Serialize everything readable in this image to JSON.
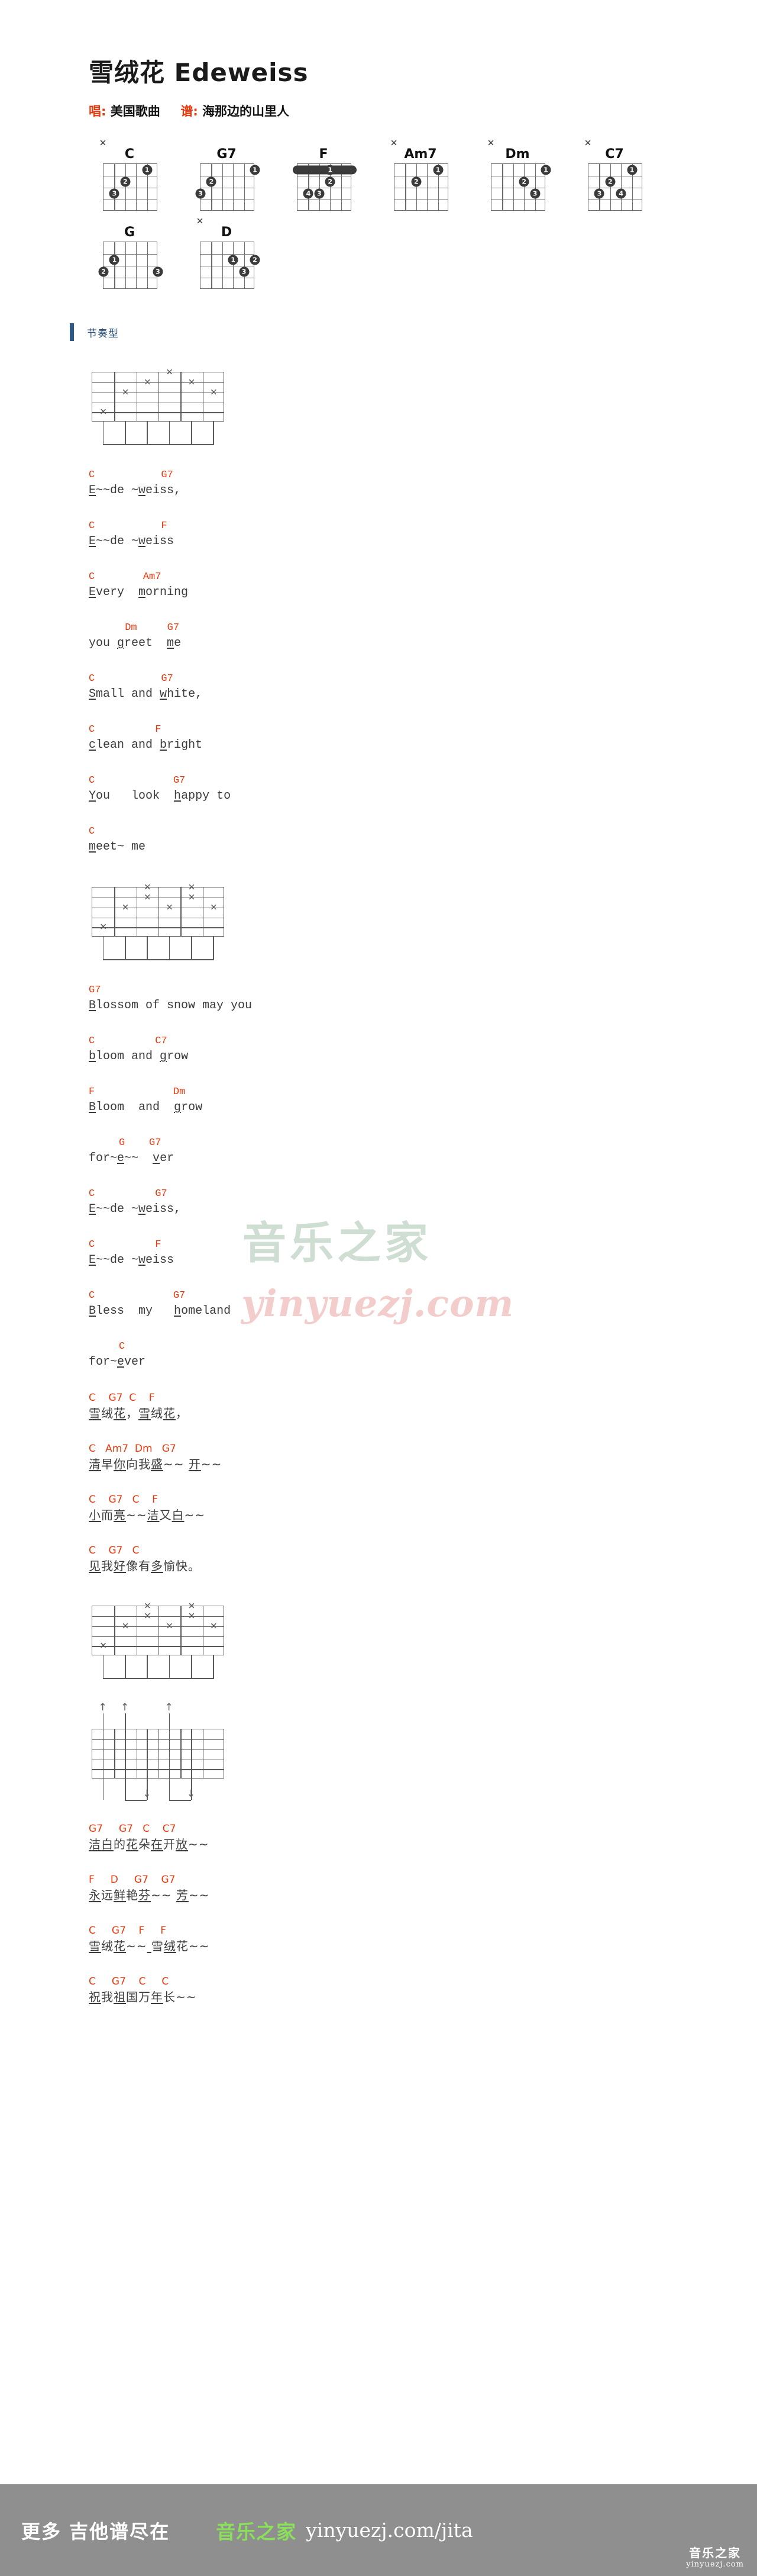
{
  "header": {
    "title": "雪绒花 Edeweiss",
    "singer_label": "唱:",
    "singer": "美国歌曲",
    "transcriber_label": "谱:",
    "transcriber": "海那边的山里人"
  },
  "chords": [
    {
      "name": "C",
      "mute_strings": [
        6
      ],
      "dots": [
        {
          "string": 2,
          "fret": 1,
          "finger": "1"
        },
        {
          "string": 4,
          "fret": 2,
          "finger": "2"
        },
        {
          "string": 5,
          "fret": 3,
          "finger": "3"
        }
      ],
      "barre": null
    },
    {
      "name": "G7",
      "mute_strings": [],
      "dots": [
        {
          "string": 1,
          "fret": 1,
          "finger": "1"
        },
        {
          "string": 5,
          "fret": 2,
          "finger": "2"
        },
        {
          "string": 6,
          "fret": 3,
          "finger": "3"
        }
      ],
      "barre": null
    },
    {
      "name": "F",
      "mute_strings": [],
      "dots": [
        {
          "string": 3,
          "fret": 2,
          "finger": "2"
        },
        {
          "string": 4,
          "fret": 3,
          "finger": "3"
        },
        {
          "string": 5,
          "fret": 3,
          "finger": "4"
        }
      ],
      "barre": {
        "fret": 1,
        "finger": "1",
        "from_string": 6,
        "to_string": 1
      }
    },
    {
      "name": "Am7",
      "mute_strings": [
        6
      ],
      "dots": [
        {
          "string": 2,
          "fret": 1,
          "finger": "1"
        },
        {
          "string": 4,
          "fret": 2,
          "finger": "2"
        }
      ],
      "barre": null
    },
    {
      "name": "Dm",
      "mute_strings": [
        6
      ],
      "dots": [
        {
          "string": 1,
          "fret": 1,
          "finger": "1"
        },
        {
          "string": 3,
          "fret": 2,
          "finger": "2"
        },
        {
          "string": 2,
          "fret": 3,
          "finger": "3"
        }
      ],
      "barre": null
    },
    {
      "name": "C7",
      "mute_strings": [
        6
      ],
      "dots": [
        {
          "string": 2,
          "fret": 1,
          "finger": "1"
        },
        {
          "string": 4,
          "fret": 2,
          "finger": "2"
        },
        {
          "string": 5,
          "fret": 3,
          "finger": "3"
        },
        {
          "string": 3,
          "fret": 3,
          "finger": "4"
        }
      ],
      "barre": null
    },
    {
      "name": "G",
      "mute_strings": [],
      "dots": [
        {
          "string": 5,
          "fret": 2,
          "finger": "1"
        },
        {
          "string": 6,
          "fret": 3,
          "finger": "2"
        },
        {
          "string": 1,
          "fret": 3,
          "finger": "3"
        }
      ],
      "barre": null
    },
    {
      "name": "D",
      "mute_strings": [
        6
      ],
      "dots": [
        {
          "string": 3,
          "fret": 2,
          "finger": "1"
        },
        {
          "string": 1,
          "fret": 2,
          "finger": "2"
        },
        {
          "string": 2,
          "fret": 3,
          "finger": "3"
        }
      ],
      "barre": null
    }
  ],
  "section": {
    "rhythm_label": "节奏型"
  },
  "staves": [
    {
      "id": "staff-1",
      "notes": [
        {
          "beat": 1,
          "string": 5,
          "mark": "x"
        },
        {
          "beat": 2,
          "string": 3,
          "mark": "x"
        },
        {
          "beat": 3,
          "string": 2,
          "mark": "x"
        },
        {
          "beat": 4,
          "string": 1,
          "mark": "x"
        },
        {
          "beat": 5,
          "string": 2,
          "mark": "x"
        },
        {
          "beat": 6,
          "string": 3,
          "mark": "x"
        }
      ],
      "beamed": true,
      "arrows": []
    },
    {
      "id": "staff-2",
      "notes": [
        {
          "beat": 1,
          "string": 5,
          "mark": "x"
        },
        {
          "beat": 2,
          "string": 3,
          "mark": "x"
        },
        {
          "beat": 3,
          "string": 1,
          "mark": "x"
        },
        {
          "beat": 3,
          "string": 2,
          "mark": "x"
        },
        {
          "beat": 4,
          "string": 3,
          "mark": "x"
        },
        {
          "beat": 5,
          "string": 1,
          "mark": "x"
        },
        {
          "beat": 5,
          "string": 2,
          "mark": "x"
        },
        {
          "beat": 6,
          "string": 3,
          "mark": "x"
        }
      ],
      "beamed": true,
      "arrows": []
    },
    {
      "id": "staff-3",
      "notes": [
        {
          "beat": 1,
          "string": 5,
          "mark": "x"
        },
        {
          "beat": 2,
          "string": 3,
          "mark": "x"
        },
        {
          "beat": 3,
          "string": 1,
          "mark": "x"
        },
        {
          "beat": 3,
          "string": 2,
          "mark": "x"
        },
        {
          "beat": 4,
          "string": 3,
          "mark": "x"
        },
        {
          "beat": 5,
          "string": 1,
          "mark": "x"
        },
        {
          "beat": 5,
          "string": 2,
          "mark": "x"
        },
        {
          "beat": 6,
          "string": 3,
          "mark": "x"
        }
      ],
      "beamed": true,
      "arrows": []
    },
    {
      "id": "staff-4",
      "notes": [],
      "beamed": false,
      "arrows": [
        {
          "beat": 1,
          "dir": "up"
        },
        {
          "beat": 2,
          "dir": "up"
        },
        {
          "beat": 3,
          "dir": "down"
        },
        {
          "beat": 4,
          "dir": "up"
        },
        {
          "beat": 5,
          "dir": "down"
        }
      ]
    }
  ],
  "verses": [
    {
      "after_staff": 1,
      "lines": [
        {
          "chords": "C           G7",
          "text": "E~~de ~weiss,",
          "cn": false,
          "u": [
            [
              0,
              1
            ],
            [
              7,
              8
            ]
          ]
        },
        {
          "chords": "C           F",
          "text": "E~~de ~weiss",
          "cn": false,
          "u": [
            [
              0,
              1
            ],
            [
              7,
              8
            ]
          ]
        },
        {
          "chords": "C        Am7",
          "text": "Every  morning",
          "cn": false,
          "u": [
            [
              0,
              1
            ],
            [
              7,
              8
            ]
          ]
        },
        {
          "chords": "      Dm     G7",
          "text": "you greet  me",
          "cn": false,
          "u": [
            [
              4,
              5
            ],
            [
              11,
              12
            ]
          ]
        },
        {
          "chords": "C           G7",
          "text": "Small and white,",
          "cn": false,
          "u": [
            [
              0,
              1
            ],
            [
              10,
              11
            ]
          ]
        },
        {
          "chords": "C          F",
          "text": "clean and bright",
          "cn": false,
          "u": [
            [
              0,
              1
            ],
            [
              10,
              11
            ]
          ]
        },
        {
          "chords": "C             G7",
          "text": "You   look  happy to",
          "cn": false,
          "u": [
            [
              0,
              1
            ],
            [
              12,
              13
            ]
          ]
        },
        {
          "chords": "C",
          "text": "meet~ me",
          "cn": false,
          "u": [
            [
              0,
              1
            ]
          ]
        }
      ]
    },
    {
      "after_staff": 2,
      "lines": [
        {
          "chords": "G7",
          "text": "Blossom of snow may you",
          "cn": false,
          "u": [
            [
              0,
              1
            ]
          ]
        },
        {
          "chords": "C          C7",
          "text": "bloom and grow",
          "cn": false,
          "u": [
            [
              0,
              1
            ],
            [
              10,
              11
            ]
          ]
        },
        {
          "chords": "F             Dm",
          "text": "Bloom  and  grow",
          "cn": false,
          "u": [
            [
              0,
              1
            ],
            [
              12,
              13
            ]
          ]
        },
        {
          "chords": "     G    G7",
          "text": "for~e~~  ver",
          "cn": false,
          "u": [
            [
              4,
              5
            ],
            [
              9,
              10
            ]
          ]
        },
        {
          "chords": "C          G7",
          "text": "E~~de ~weiss,",
          "cn": false,
          "u": [
            [
              0,
              1
            ],
            [
              7,
              8
            ]
          ]
        },
        {
          "chords": "C          F",
          "text": "E~~de ~weiss",
          "cn": false,
          "u": [
            [
              0,
              1
            ],
            [
              7,
              8
            ]
          ]
        },
        {
          "chords": "C             G7",
          "text": "Bless  my   homeland",
          "cn": false,
          "u": [
            [
              0,
              1
            ],
            [
              12,
              13
            ]
          ]
        },
        {
          "chords": "     C",
          "text": "for~ever",
          "cn": false,
          "u": [
            [
              4,
              5
            ]
          ]
        }
      ]
    },
    {
      "after_staff": 2,
      "cn_block": true,
      "lines": [
        {
          "chords": "C    G7  C    F",
          "text": "雪绒花，雪绒花，",
          "cn": true,
          "u": [
            [
              0,
              1
            ],
            [
              2,
              3
            ],
            [
              4,
              5
            ],
            [
              6,
              7
            ]
          ]
        },
        {
          "chords": "C   Am7  Dm   G7",
          "text": "清早你向我盛~~ 开~~",
          "cn": true,
          "u": [
            [
              0,
              1
            ],
            [
              2,
              3
            ],
            [
              5,
              6
            ],
            [
              9,
              10
            ]
          ]
        },
        {
          "chords": "C    G7   C    F",
          "text": "小而亮~~洁又白~~",
          "cn": true,
          "u": [
            [
              0,
              1
            ],
            [
              2,
              3
            ],
            [
              5,
              6
            ],
            [
              7,
              8
            ]
          ]
        },
        {
          "chords": "C    G7   C",
          "text": "见我好像有多愉快。",
          "cn": true,
          "u": [
            [
              0,
              1
            ],
            [
              2,
              3
            ],
            [
              5,
              6
            ]
          ]
        }
      ]
    },
    {
      "after_staff": 4,
      "cn_block": true,
      "lines": [
        {
          "chords": "G7     G7   C    C7",
          "text": "洁白的花朵在开放~~",
          "cn": true,
          "u": [
            [
              0,
              1
            ],
            [
              1,
              2
            ],
            [
              3,
              4
            ],
            [
              5,
              6
            ],
            [
              7,
              8
            ]
          ]
        },
        {
          "chords": "F     D     G7    G7",
          "text": "永远鲜艳芬~~ 芳~~",
          "cn": true,
          "u": [
            [
              0,
              1
            ],
            [
              2,
              3
            ],
            [
              4,
              5
            ],
            [
              8,
              9
            ]
          ]
        },
        {
          "chords": "C     G7    F     F",
          "text": "雪绒花~~ 雪绒花~~",
          "cn": true,
          "u": [
            [
              0,
              1
            ],
            [
              2,
              3
            ],
            [
              5,
              6
            ],
            [
              7,
              8
            ]
          ]
        },
        {
          "chords": "C     G7    C     C",
          "text": "祝我祖国万年长~~",
          "cn": true,
          "u": [
            [
              0,
              1
            ],
            [
              2,
              3
            ],
            [
              5,
              6
            ]
          ]
        }
      ]
    }
  ],
  "watermark": {
    "cn": "音乐之家",
    "en": "yinyuezj.com"
  },
  "footer": {
    "left_text": "更多 吉他谱尽在",
    "brand": "音乐之家",
    "url": "yinyuezj.com/jita",
    "badge_cn": "音乐之家",
    "badge_url": "yinyuezj.com"
  }
}
